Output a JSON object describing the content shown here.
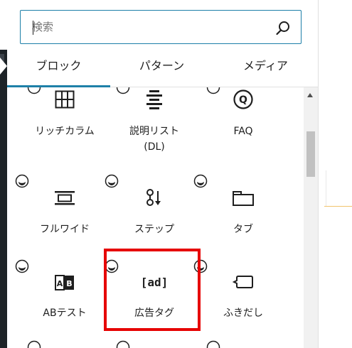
{
  "search": {
    "placeholder": "検索",
    "value": ""
  },
  "tabs": [
    {
      "label": "ブロック",
      "active": true
    },
    {
      "label": "パターン",
      "active": false
    },
    {
      "label": "メディア",
      "active": false
    }
  ],
  "blocks": {
    "row1": [
      {
        "label": "リッチカラム",
        "icon": "columns-icon"
      },
      {
        "label": "説明リスト\n(DL)",
        "icon": "list-icon"
      },
      {
        "label": "FAQ",
        "icon": "faq-q-icon"
      }
    ],
    "row2": [
      {
        "label": "フルワイド",
        "icon": "fullwide-icon"
      },
      {
        "label": "ステップ",
        "icon": "steps-icon"
      },
      {
        "label": "タブ",
        "icon": "tab-icon"
      }
    ],
    "row3": [
      {
        "label": "ABテスト",
        "icon": "ab-test-icon"
      },
      {
        "label": "広告タグ",
        "icon_text": "[ad]",
        "icon": "ad-tag-icon"
      },
      {
        "label": "ふきだし",
        "icon": "speech-bubble-icon"
      }
    ]
  },
  "colors": {
    "accent": "#1e80a8",
    "highlight": "#e60000",
    "admin_bar": "#1d2327"
  }
}
